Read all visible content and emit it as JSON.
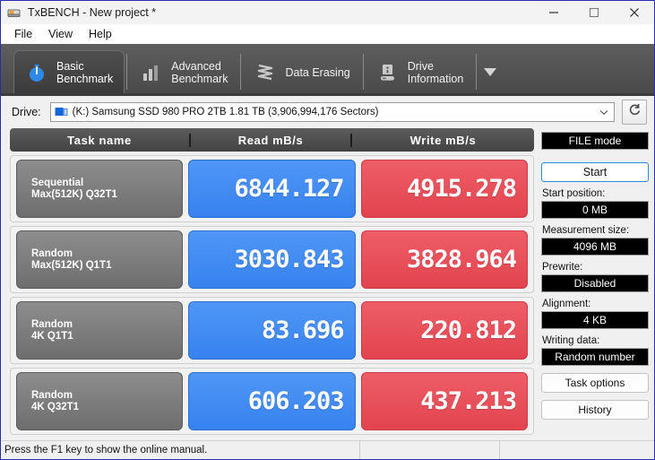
{
  "window": {
    "title": "TxBENCH - New project *",
    "app_icon": "drive-icon",
    "controls": {
      "minimize": "minimize-icon",
      "maximize": "maximize-icon",
      "close": "close-icon"
    }
  },
  "menu": {
    "items": [
      {
        "label": "File"
      },
      {
        "label": "View"
      },
      {
        "label": "Help"
      }
    ]
  },
  "tabs": {
    "items": [
      {
        "label": "Basic\nBenchmark",
        "icon": "stopwatch-icon",
        "active": true
      },
      {
        "label": "Advanced\nBenchmark",
        "icon": "bar-chart-icon",
        "active": false
      },
      {
        "label": "Data Erasing",
        "icon": "shredder-icon",
        "active": false
      },
      {
        "label": "Drive\nInformation",
        "icon": "hard-drive-icon",
        "active": false
      }
    ],
    "overflow_icon": "chevron-down-icon"
  },
  "drive": {
    "label": "Drive:",
    "selected": "(K:) Samsung SSD 980 PRO 2TB  1.81 TB (3,906,994,176 Sectors)",
    "dropdown_icon": "chevron-down-icon",
    "drive_icon": "drive-small-icon",
    "refresh_icon": "refresh-icon"
  },
  "results": {
    "headers": {
      "task": "Task name",
      "read": "Read mB/s",
      "write": "Write mB/s"
    },
    "rows": [
      {
        "task": "Sequential\nMax(512K) Q32T1",
        "read": "6844.127",
        "write": "4915.278"
      },
      {
        "task": "Random\nMax(512K) Q1T1",
        "read": "3030.843",
        "write": "3828.964"
      },
      {
        "task": "Random\n4K Q1T1",
        "read": "83.696",
        "write": "220.812"
      },
      {
        "task": "Random\n4K Q32T1",
        "read": "606.203",
        "write": "437.213"
      }
    ]
  },
  "sidepanel": {
    "mode": "FILE mode",
    "start_button": "Start",
    "start_position_label": "Start position:",
    "start_position_value": "0 MB",
    "measurement_size_label": "Measurement size:",
    "measurement_size_value": "4096 MB",
    "prewrite_label": "Prewrite:",
    "prewrite_value": "Disabled",
    "alignment_label": "Alignment:",
    "alignment_value": "4 KB",
    "writing_data_label": "Writing data:",
    "writing_data_value": "Random number",
    "task_options_button": "Task options",
    "history_button": "History"
  },
  "statusbar": {
    "message": "Press the F1 key to show the online manual."
  },
  "colors": {
    "read_bar": "#3782ef",
    "write_bar": "#e2444f",
    "accent": "#2e8ad8",
    "tab_bg": "#4a4a4a"
  }
}
